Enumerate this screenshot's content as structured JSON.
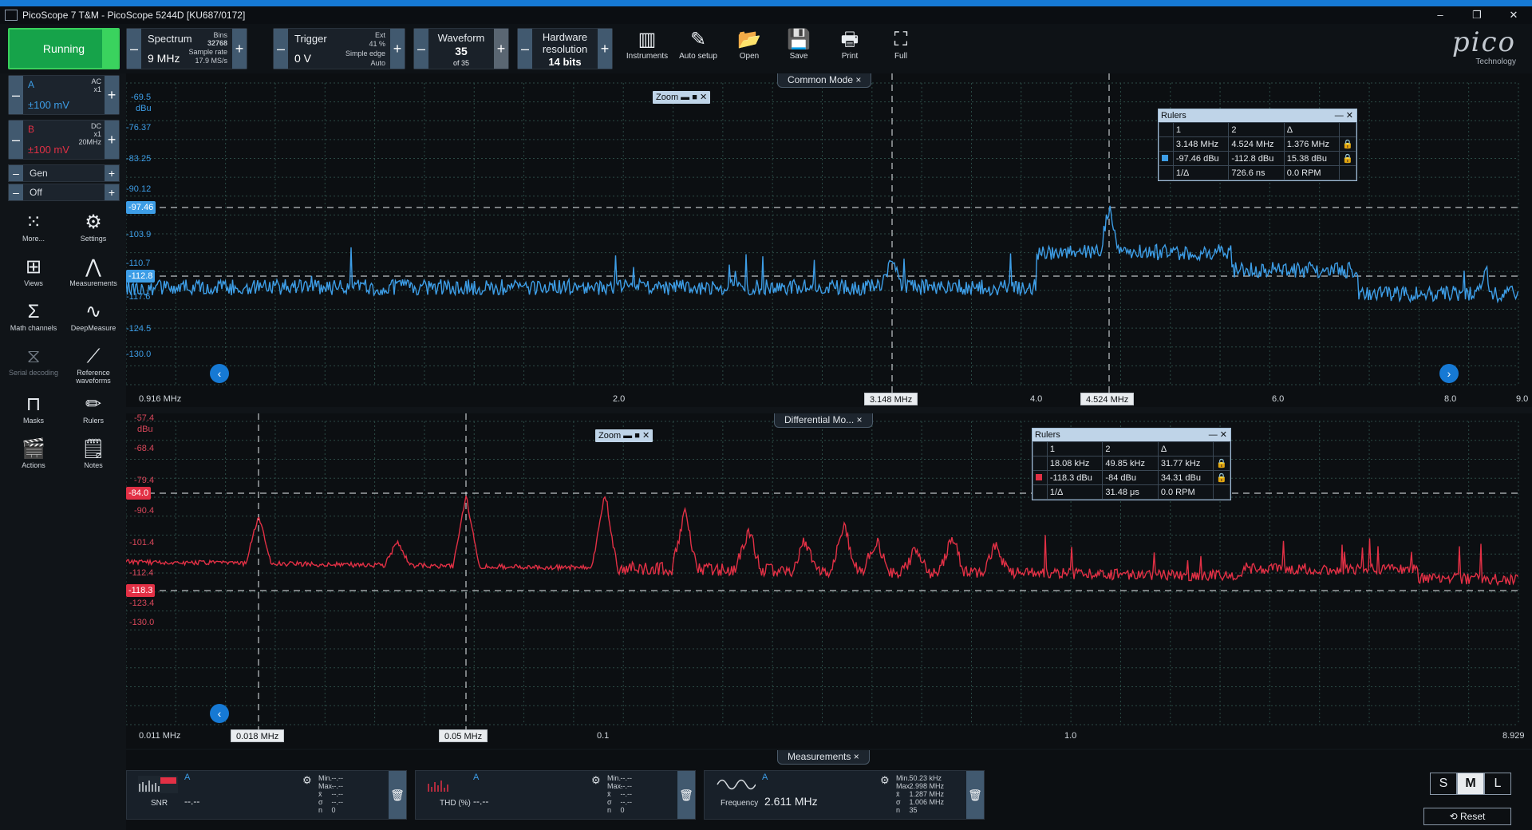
{
  "window": {
    "title": "PicoScope 7 T&M  - PicoScope 5244D [KU687/0172]",
    "buttons": [
      "–",
      "❐",
      "✕"
    ]
  },
  "toolbar": {
    "run_label": "Running",
    "spectrum": {
      "title": "Spectrum",
      "value": "9 MHz",
      "bins_label": "Bins",
      "bins": "32768",
      "rate_label": "Sample rate",
      "rate": "17.9 MS/s"
    },
    "trigger": {
      "title": "Trigger",
      "value": "0 V",
      "ext": "Ext",
      "pct": "41 %",
      "mode": "Simple edge",
      "auto": "Auto"
    },
    "waveform": {
      "title": "Waveform",
      "value": "35",
      "of": "of 35"
    },
    "hw": {
      "title1": "Hardware",
      "title2": "resolution",
      "value": "14 bits"
    },
    "tools": [
      {
        "name": "Instruments",
        "icon": "▥"
      },
      {
        "name": "Auto setup",
        "icon": "✎"
      },
      {
        "name": "Open",
        "icon": "📂"
      },
      {
        "name": "Save",
        "icon": "💾"
      },
      {
        "name": "Print",
        "icon": "🖶"
      },
      {
        "name": "Full",
        "icon": "⛶"
      }
    ],
    "logo": "pico",
    "logo_sub": "Technology"
  },
  "channels": {
    "a": {
      "name": "A",
      "coupling": "AC",
      "probe": "x1",
      "range": "±100 mV",
      "color": "#3d9de6"
    },
    "b": {
      "name": "B",
      "coupling": "DC",
      "probe": "x1",
      "bw": "20MHz",
      "range": "±100 mV",
      "color": "#e23045"
    },
    "gen": "Gen",
    "off": "Off"
  },
  "nav": [
    {
      "label": "More...",
      "icon": "⁙"
    },
    {
      "label": "Settings",
      "icon": "⚙"
    },
    {
      "label": "Views",
      "icon": "⊞"
    },
    {
      "label": "Measurements",
      "icon": "⋀"
    },
    {
      "label": "Math channels",
      "icon": "Σ"
    },
    {
      "label": "DeepMeasure",
      "icon": "∿"
    },
    {
      "label": "Serial decoding",
      "icon": "⧖"
    },
    {
      "label": "Reference waveforms",
      "icon": "⟋"
    },
    {
      "label": "Masks",
      "icon": "⊓"
    },
    {
      "label": "Rulers",
      "icon": "✏"
    },
    {
      "label": "Actions",
      "icon": "🎬"
    },
    {
      "label": "Notes",
      "icon": "🗒"
    }
  ],
  "view1": {
    "tab": "Common Mode ×",
    "unit": "dBu",
    "yticks": [
      "-69.5",
      "-76.37",
      "-83.25",
      "-90.12",
      "-103.9",
      "-110.7",
      "-117.6",
      "-124.5",
      "-130.0"
    ],
    "marker1": "-97.46",
    "marker2": "-112.8",
    "xticks": [
      "0.916 MHz",
      "2.0",
      "4.0",
      "6.0",
      "8.0",
      "9.0"
    ],
    "ruler1": "3.148 MHz",
    "ruler2": "4.524 MHz",
    "zoom": "Zoom",
    "rulers": {
      "title": "Rulers",
      "h1": "1",
      "h2": "2",
      "hd": "Δ",
      "r1": [
        "3.148 MHz",
        "4.524 MHz",
        "1.376 MHz"
      ],
      "r2": [
        "-97.46 dBu",
        "-112.8 dBu",
        "15.38 dBu"
      ],
      "r3": [
        "1/Δ",
        "726.6 ns",
        "0.0 RPM"
      ]
    },
    "color": "#3d9de6"
  },
  "view2": {
    "tab": "Differential Mo... ×",
    "unit": "dBu",
    "yticks": [
      "-57.4",
      "-68.4",
      "-79.4",
      "-90.4",
      "-101.4",
      "-112.4",
      "-123.4",
      "-130.0"
    ],
    "marker1": "-84.0",
    "marker2": "-118.3",
    "xticks": [
      "0.011 MHz",
      "0.1",
      "1.0",
      "8.929"
    ],
    "ruler1": "0.018 MHz",
    "ruler2": "0.05 MHz",
    "zoom": "Zoom",
    "rulers": {
      "title": "Rulers",
      "h1": "1",
      "h2": "2",
      "hd": "Δ",
      "r1": [
        "18.08 kHz",
        "49.85 kHz",
        "31.77 kHz"
      ],
      "r2": [
        "-118.3 dBu",
        "-84 dBu",
        "34.31 dBu"
      ],
      "r3": [
        "1/Δ",
        "31.48 μs",
        "0.0 RPM"
      ]
    },
    "color": "#e23045"
  },
  "measurements": {
    "tab": "Measurements ×",
    "items": [
      {
        "name": "SNR",
        "ch": "A",
        "value": "--.--",
        "stats": [
          [
            "Min.",
            "--.--"
          ],
          [
            "Max.",
            "--.--"
          ],
          [
            "x̄",
            "--.--"
          ],
          [
            "σ",
            "--.--"
          ],
          [
            "n",
            "0"
          ]
        ]
      },
      {
        "name": "THD (%)",
        "ch": "A",
        "value": "--.--",
        "stats": [
          [
            "Min.",
            "--.--"
          ],
          [
            "Max.",
            "--.--"
          ],
          [
            "x̄",
            "--.--"
          ],
          [
            "σ",
            "--.--"
          ],
          [
            "n",
            "0"
          ]
        ]
      },
      {
        "name": "Frequency",
        "ch": "A",
        "value": "2.611 MHz",
        "stats": [
          [
            "Min.",
            "50.23 kHz"
          ],
          [
            "Max.",
            "2.998 MHz"
          ],
          [
            "x̄",
            "1.287 MHz"
          ],
          [
            "σ",
            "1.006 MHz"
          ],
          [
            "n",
            "35"
          ]
        ]
      }
    ]
  },
  "size": {
    "s": "S",
    "m": "M",
    "l": "L"
  },
  "reset": "Reset"
}
